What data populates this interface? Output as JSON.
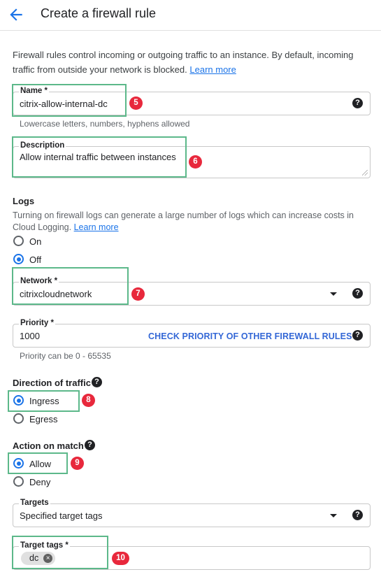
{
  "header": {
    "title": "Create a firewall rule"
  },
  "intro": {
    "text": "Firewall rules control incoming or outgoing traffic to an instance. By default, incoming traffic from outside your network is blocked.",
    "link": "Learn more"
  },
  "name_field": {
    "label": "Name *",
    "value": "citrix-allow-internal-dc",
    "hint": "Lowercase letters, numbers, hyphens allowed"
  },
  "description_field": {
    "label": "Description",
    "value": "Allow internal traffic between instances"
  },
  "logs": {
    "title": "Logs",
    "text": "Turning on firewall logs can generate a large number of logs which can increase costs in Cloud Logging.",
    "link": "Learn more",
    "options": [
      "On",
      "Off"
    ],
    "selected": "Off"
  },
  "network_field": {
    "label": "Network *",
    "value": "citrixcloudnetwork"
  },
  "priority_field": {
    "label": "Priority *",
    "value": "1000",
    "action": "CHECK PRIORITY OF OTHER FIREWALL RULES",
    "hint": "Priority can be 0 - 65535"
  },
  "direction": {
    "title": "Direction of traffic",
    "options": [
      "Ingress",
      "Egress"
    ],
    "selected": "Ingress"
  },
  "action": {
    "title": "Action on match",
    "options": [
      "Allow",
      "Deny"
    ],
    "selected": "Allow"
  },
  "targets_field": {
    "label": "Targets",
    "value": "Specified target tags"
  },
  "target_tags_field": {
    "label": "Target tags *",
    "chips": [
      "dc"
    ]
  },
  "callouts": [
    "5",
    "6",
    "7",
    "8",
    "9",
    "10"
  ],
  "icons": {
    "back": "arrow-back-icon",
    "help": "help-circle-icon",
    "dropdown": "dropdown-caret-icon",
    "chip_remove": "close-circle-icon"
  },
  "colors": {
    "accent": "#1a73e8",
    "highlight_box": "#5cb88a",
    "callout_badge": "#e8283c",
    "link": "#1a73e8"
  }
}
